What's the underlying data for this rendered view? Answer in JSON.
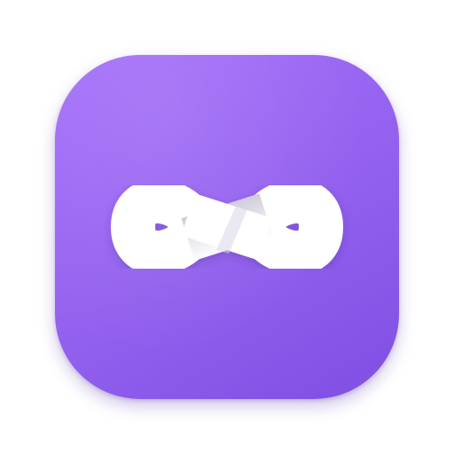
{
  "app_icon": {
    "name": "infinity-app",
    "glyph": "infinity-icon",
    "colors": {
      "gradient_start": "#a56ffa",
      "gradient_mid": "#9462ef",
      "gradient_end": "#7f4fe3",
      "glyph": "#ffffff",
      "crossover_shadow": "#d9d5e3"
    }
  }
}
